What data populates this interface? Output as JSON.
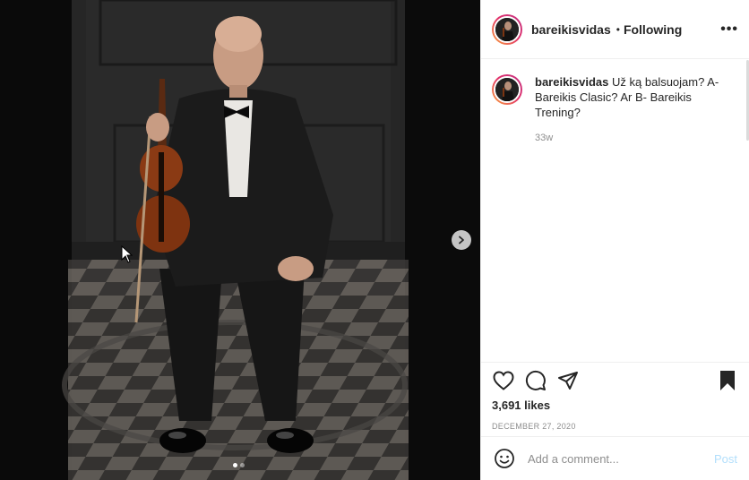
{
  "post": {
    "username": "bareikisvidas",
    "separator": "•",
    "follow_status": "Following",
    "more_icon": "more-options-icon"
  },
  "caption": {
    "username": "bareikisvidas",
    "text": "Už ką balsuojam? A- Bareikis Clasic? Ar B- Bareikis Trening?",
    "time": "33w"
  },
  "actions": {
    "likes": "3,691 likes",
    "date": "DECEMBER 27, 2020"
  },
  "comment": {
    "placeholder": "Add a comment...",
    "post_label": "Post"
  },
  "media": {
    "slide_count": 2,
    "active_slide": 1
  },
  "colors": {
    "story_ring_start": "#f9a43c",
    "story_ring_end": "#c13584",
    "post_disabled": "#b2dffc",
    "secondary_text": "#8e8e8e"
  }
}
